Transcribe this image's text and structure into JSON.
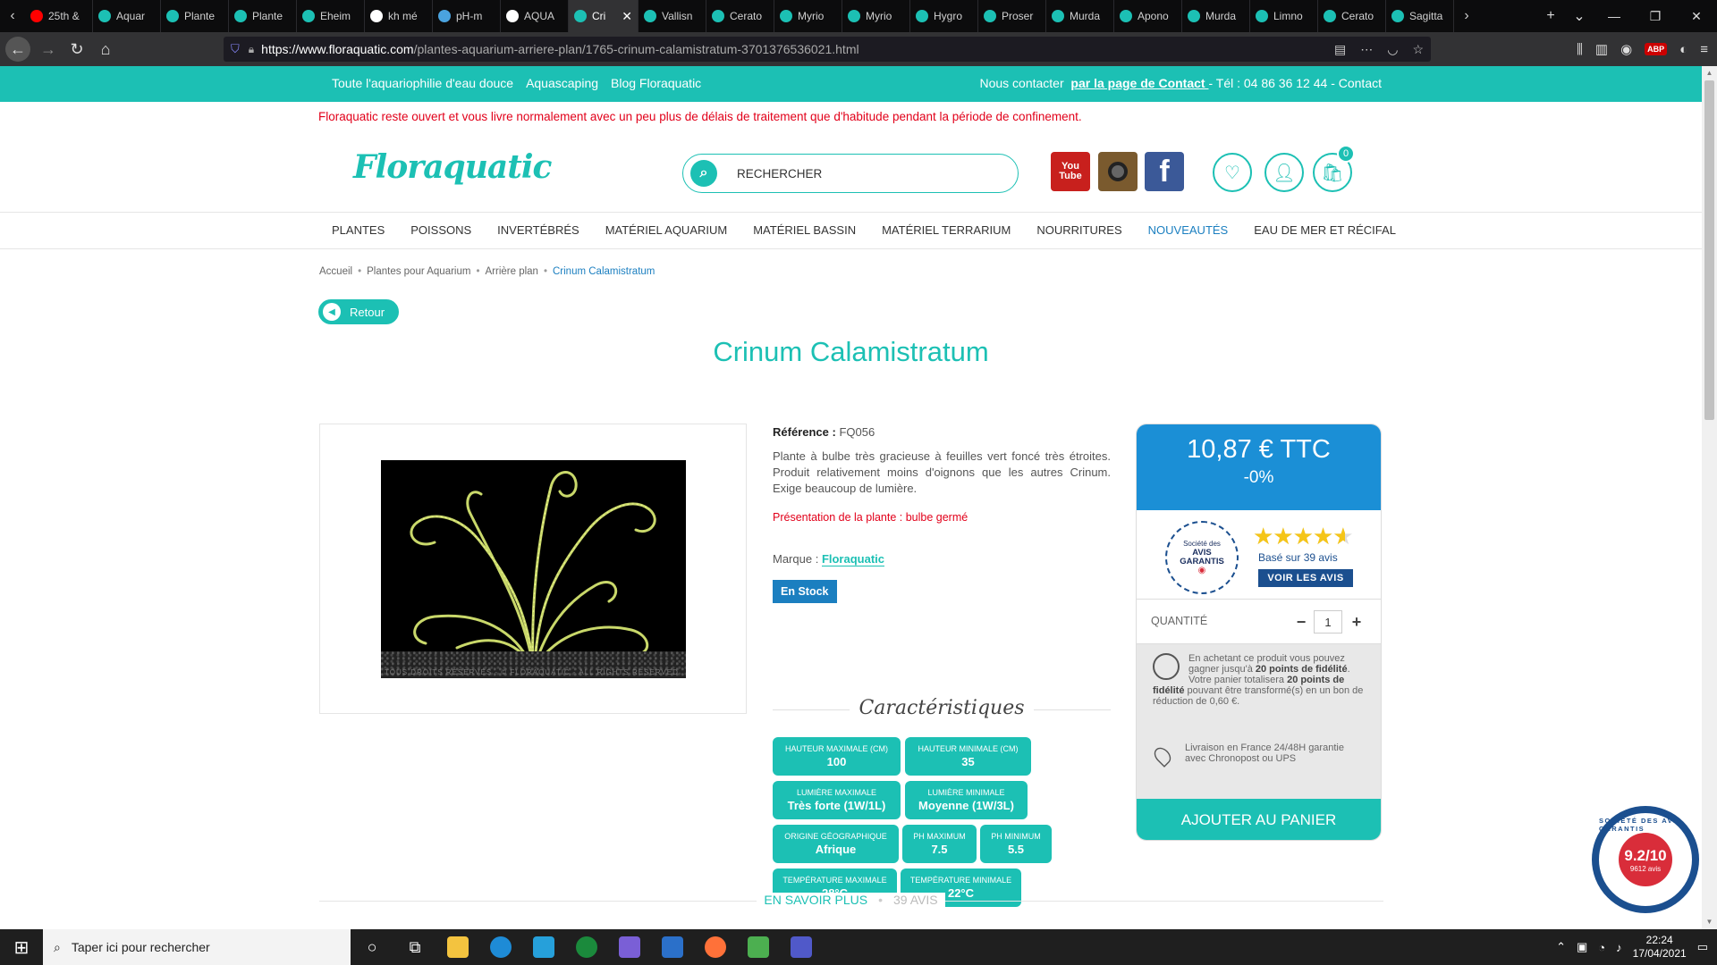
{
  "browser": {
    "tabs": [
      {
        "label": "25th &",
        "color": "#ff0000"
      },
      {
        "label": "Aquar",
        "color": "#1cc0b4"
      },
      {
        "label": "Plante",
        "color": "#1cc0b4"
      },
      {
        "label": "Plante",
        "color": "#1cc0b4"
      },
      {
        "label": "Eheim",
        "color": "#1cc0b4"
      },
      {
        "label": "kh mé",
        "color": "#ffffff"
      },
      {
        "label": "pH-m",
        "color": "#4aa3df"
      },
      {
        "label": "AQUA",
        "color": "#ffffff"
      },
      {
        "label": "Cri",
        "color": "#1cc0b4",
        "active": true
      },
      {
        "label": "Vallisn",
        "color": "#1cc0b4"
      },
      {
        "label": "Cerato",
        "color": "#1cc0b4"
      },
      {
        "label": "Myrio",
        "color": "#1cc0b4"
      },
      {
        "label": "Myrio",
        "color": "#1cc0b4"
      },
      {
        "label": "Hygro",
        "color": "#1cc0b4"
      },
      {
        "label": "Proser",
        "color": "#1cc0b4"
      },
      {
        "label": "Murda",
        "color": "#1cc0b4"
      },
      {
        "label": "Apono",
        "color": "#1cc0b4"
      },
      {
        "label": "Murda",
        "color": "#1cc0b4"
      },
      {
        "label": "Limno",
        "color": "#1cc0b4"
      },
      {
        "label": "Cerato",
        "color": "#1cc0b4"
      },
      {
        "label": "Sagitta",
        "color": "#1cc0b4"
      }
    ],
    "url_domain": "https://www.floraquatic.com",
    "url_path": "/plantes-aquarium-arriere-plan/1765-crinum-calamistratum-3701376536021.html"
  },
  "topbar": {
    "links": [
      "Toute l'aquariophilie d'eau douce",
      "Aquascaping",
      "Blog Floraquatic"
    ],
    "contact_prefix": "Nous contacter",
    "contact_link": "par la page de Contact ",
    "contact_suffix": "- Tél : 04 86 36 12 44 - Contact"
  },
  "notice": "Floraquatic reste ouvert et vous livre normalement avec un peu plus de délais de traitement que d'habitude pendant la période de confinement.",
  "header": {
    "logo": "Floraquatic",
    "search_placeholder": "RECHERCHER",
    "youtube_label": "You Tube",
    "cart_count": "0"
  },
  "nav": [
    "PLANTES",
    "POISSONS",
    "INVERTÉBRÉS",
    "MATÉRIEL AQUARIUM",
    "MATÉRIEL BASSIN",
    "MATÉRIEL TERRARIUM",
    "NOURRITURES",
    "NOUVEAUTÉS",
    "EAU DE MER ET RÉCIFAL"
  ],
  "breadcrumb": [
    "Accueil",
    "Plantes pour Aquarium",
    "Arrière plan",
    "Crinum Calamistratum"
  ],
  "back_label": "Retour",
  "product": {
    "title": "Crinum Calamistratum",
    "image_watermark": "TOUS DROITS RÉSERVÉS - © FLORAQUATIC - ALL RIGHTS RESERVED",
    "ref_label": "Référence :",
    "ref_value": "FQ056",
    "description": "Plante à bulbe très gracieuse à feuilles vert foncé très étroites. Produit relativement moins d'oignons que les autres Crinum. Exige beaucoup de lumière.",
    "presentation": "Présentation de la plante : bulbe germé",
    "brand_label": "Marque :",
    "brand": "Floraquatic",
    "stock": "En Stock",
    "carac_title": "Caractéristiques",
    "features": [
      {
        "k": "Hauteur maximale (cm)",
        "v": "100"
      },
      {
        "k": "Hauteur minimale (cm)",
        "v": "35"
      },
      {
        "k": "Lumière maximale",
        "v": "Très forte (1W/1L)"
      },
      {
        "k": "Lumière minimale",
        "v": "Moyenne (1W/3L)"
      },
      {
        "k": "Origine géographique",
        "v": "Afrique"
      },
      {
        "k": "PH maximum",
        "v": "7.5"
      },
      {
        "k": "PH minimum",
        "v": "5.5"
      },
      {
        "k": "Température maximale",
        "v": "28°C"
      },
      {
        "k": "Température minimale",
        "v": "22°C"
      }
    ]
  },
  "buybox": {
    "price": "10,87 € TTC",
    "discount": "-0%",
    "seal_top": "Société des",
    "seal_mid": "AVIS GARANTIS",
    "stars": "★★★★★",
    "rating_fraction": 0.92,
    "reviews_text": "Basé sur 39 avis",
    "reviews_button": "VOIR LES AVIS",
    "qty_label": "QUANTITÉ",
    "qty_value": "1",
    "loyalty_text_1": "En achetant ce produit vous pouvez gagner jusqu'à ",
    "loyalty_points": "20 points de fidélité",
    "loyalty_text_2": ". Votre panier totalisera ",
    "loyalty_points_2": "20 points de fidélité",
    "loyalty_text_3": " pouvant être transformé(s) en un bon de réduction de 0,60 €.",
    "shipping": "Livraison en France 24/48H garantie avec Chronopost ou UPS",
    "add_to_cart": "AJOUTER AU PANIER"
  },
  "bottom_tabs": [
    "EN SAVOIR PLUS",
    "39 AVIS"
  ],
  "avis_badge": {
    "ring": "SOCIÉTÉ DES AVIS GARANTIS",
    "score": "9.2/10",
    "count": "9612 avis"
  },
  "taskbar": {
    "search_placeholder": "Taper ici pour rechercher",
    "time": "22:24",
    "date": "17/04/2021"
  }
}
